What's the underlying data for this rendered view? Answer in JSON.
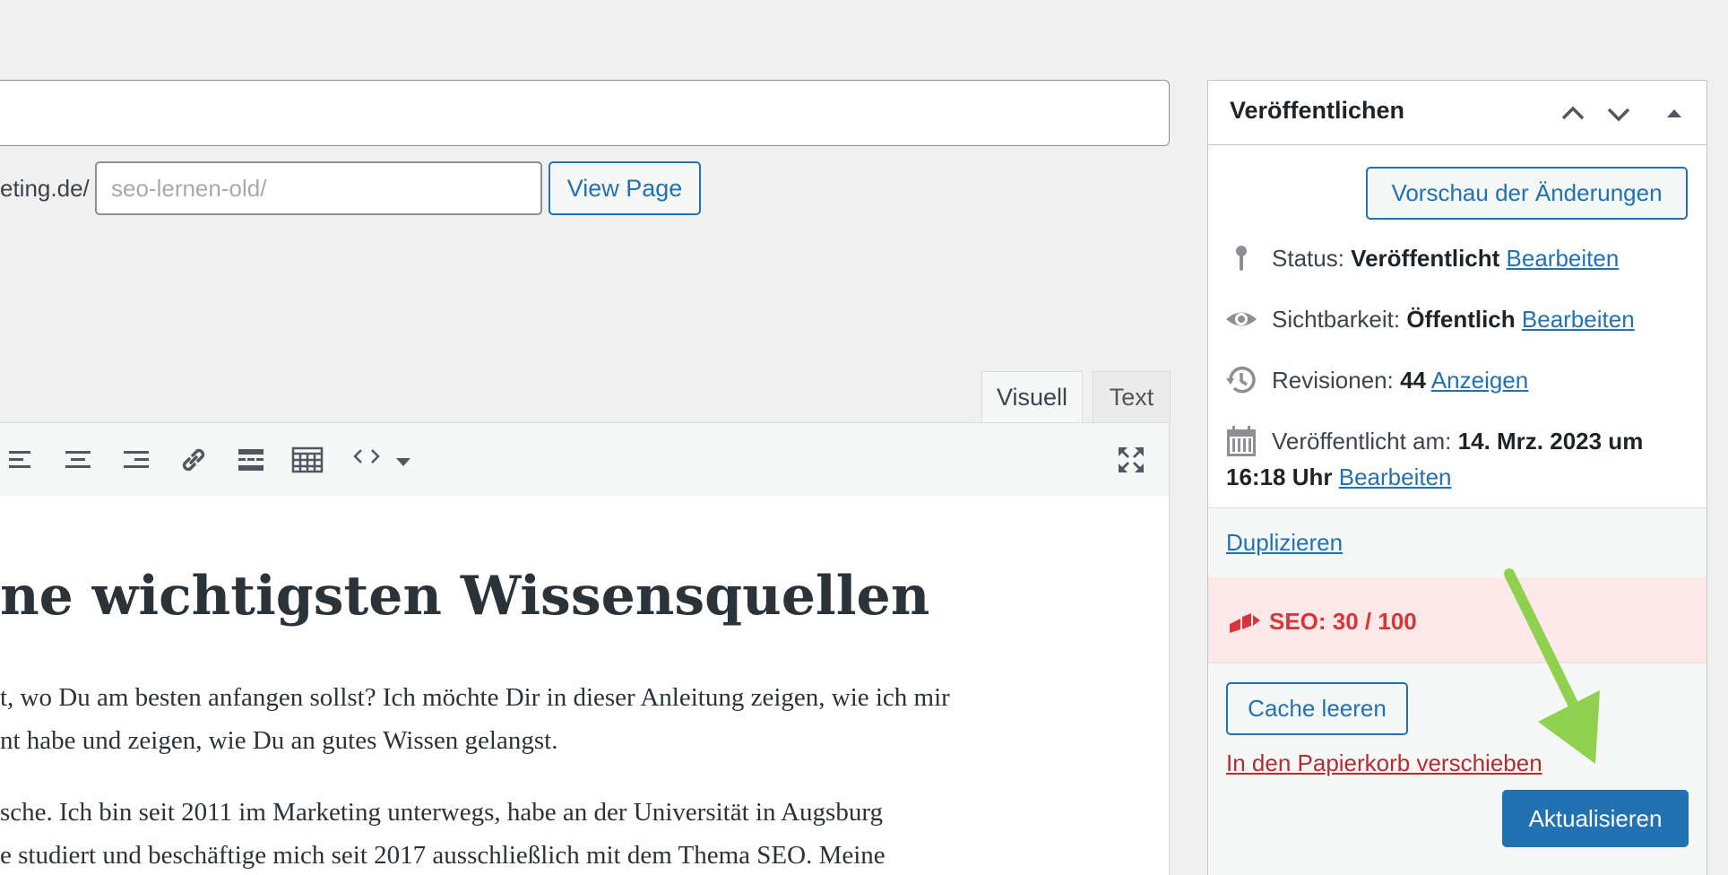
{
  "editor": {
    "permalink_prefix": "eting.de/",
    "slug_placeholder": "seo-lernen-old/",
    "view_page_label": "View Page",
    "tabs": [
      "Visuell",
      "Text"
    ],
    "heading": "ne wichtigsten Wissensquellen",
    "paragraphs": [
      "t, wo Du am besten anfangen sollst? Ich möchte Dir in dieser Anleitung zeigen, wie ich mir",
      "nt habe und zeigen, wie Du an gutes Wissen gelangst.",
      "sche. Ich bin seit 2011 im Marketing unterwegs, habe an der Universität in Augsburg",
      "e studiert und beschäftige mich seit 2017 ausschließlich mit dem Thema SEO. Meine"
    ],
    "toolbar_icons": [
      "align-left-icon",
      "align-center-icon",
      "align-right-icon",
      "link-icon",
      "read-more-icon",
      "toolbar-toggle-icon",
      "code-icon",
      "dropdown-arrow-icon",
      "fullscreen-icon"
    ]
  },
  "publish_panel": {
    "title": "Veröffentlichen",
    "preview_label": "Vorschau der Änderungen",
    "status_label": "Status:",
    "status_value": "Veröffentlicht",
    "status_edit": "Bearbeiten",
    "visibility_label": "Sichtbarkeit:",
    "visibility_value": "Öffentlich",
    "visibility_edit": "Bearbeiten",
    "revisions_label": "Revisionen:",
    "revisions_value": "44",
    "revisions_link": "Anzeigen",
    "published_label": "Veröffentlicht am:",
    "published_value_line1": "14. Mrz. 2023 um",
    "published_value_line2": "16:18 Uhr",
    "published_edit": "Bearbeiten",
    "duplicate_link": "Duplizieren",
    "seo_score": "SEO: 30 / 100",
    "cache_button": "Cache leeren",
    "trash_link": "In den Papierkorb verschieben",
    "update_button": "Aktualisieren"
  },
  "colors": {
    "accent": "#2271b1",
    "danger": "#d63638",
    "seo_bg": "#fce8e8",
    "annotation_arrow": "#8fd14f"
  }
}
